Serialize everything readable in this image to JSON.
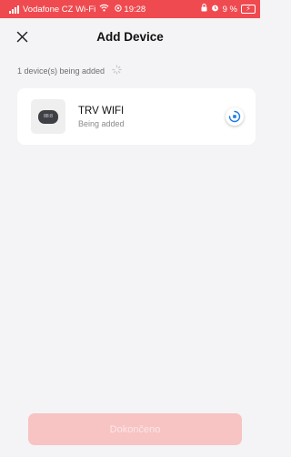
{
  "status_bar": {
    "carrier": "Vodafone CZ Wi-Fi",
    "time": "19:28",
    "battery_percent": "9 %",
    "bar_color": "#ef4a4f",
    "icons": [
      "signal-icon",
      "wifi-icon",
      "location-icon",
      "lock-rotation-icon",
      "alarm-icon",
      "battery-icon"
    ]
  },
  "header": {
    "title": "Add Device",
    "close_icon": "close-icon"
  },
  "progress": {
    "text": "1 device(s) being added"
  },
  "device": {
    "name": "TRV WIFI",
    "status": "Being added",
    "thumb_display": "88:8"
  },
  "footer": {
    "done_label": "Dokončeno",
    "button_color": "#f7c3c3"
  }
}
